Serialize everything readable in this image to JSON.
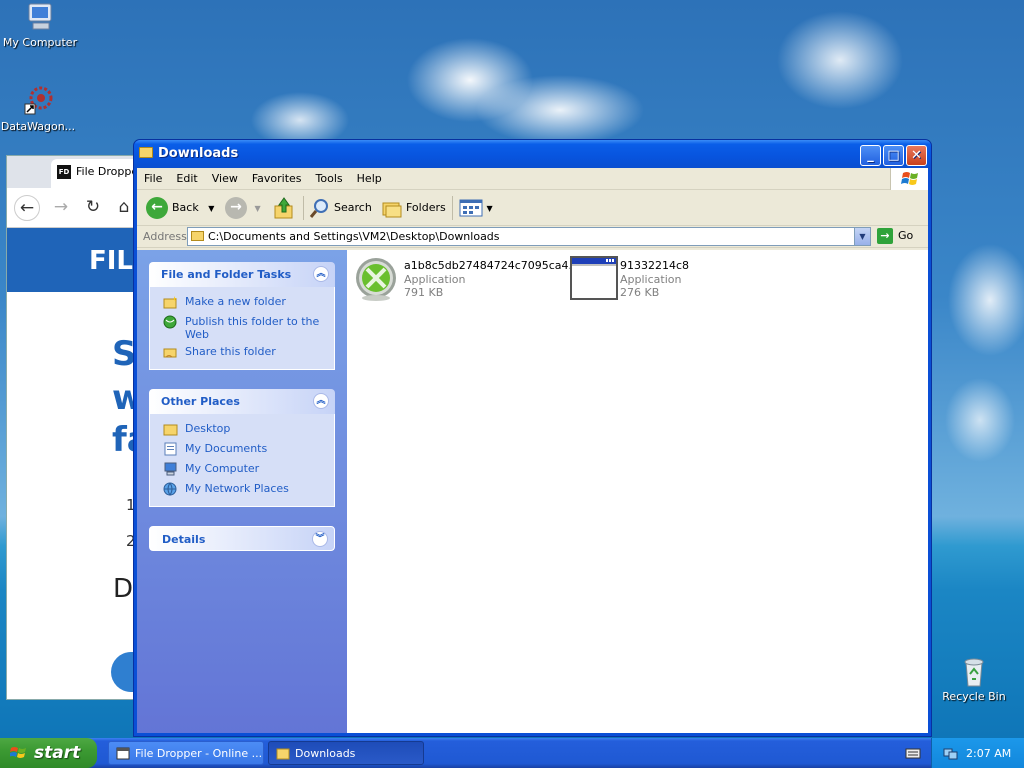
{
  "desktop": {
    "icons": [
      {
        "label": "My Computer"
      },
      {
        "label": "DataWagon..."
      },
      {
        "label": "Recycle Bin"
      }
    ]
  },
  "browser": {
    "tab_title": "File Dropper",
    "tab_favicon": "FD",
    "banner_text": "FILE",
    "big_text": [
      "S",
      "w",
      "fa"
    ],
    "list_numbers": [
      "1",
      "2"
    ],
    "d_text": "D"
  },
  "explorer": {
    "title": "Downloads",
    "menu": [
      "File",
      "Edit",
      "View",
      "Favorites",
      "Tools",
      "Help"
    ],
    "toolbar": {
      "back": "Back",
      "search": "Search",
      "folders": "Folders"
    },
    "address": {
      "label": "Address",
      "value": "C:\\Documents and Settings\\VM2\\Desktop\\Downloads",
      "go": "Go"
    },
    "tasks": {
      "file_folder": {
        "title": "File and Folder Tasks",
        "items": [
          "Make a new folder",
          "Publish this folder to the Web",
          "Share this folder"
        ]
      },
      "other_places": {
        "title": "Other Places",
        "items": [
          "Desktop",
          "My Documents",
          "My Computer",
          "My Network Places"
        ]
      },
      "details": {
        "title": "Details"
      }
    },
    "files": [
      {
        "name": "a1b8c5db27484724c7095ca4...",
        "type": "Application",
        "size": "791 KB",
        "icon": "xbox-icon"
      },
      {
        "name": "91332214c8",
        "type": "Application",
        "size": "276 KB",
        "icon": "window-app-icon"
      }
    ]
  },
  "taskbar": {
    "start_label": "start",
    "buttons": [
      {
        "label": "File Dropper - Online ...",
        "active": false
      },
      {
        "label": "Downloads",
        "active": true
      }
    ],
    "clock": "2:07 AM"
  },
  "colors": {
    "title_blue": "#0a5ee8",
    "task_link": "#215dc6",
    "start_green": "#3c9a33"
  }
}
